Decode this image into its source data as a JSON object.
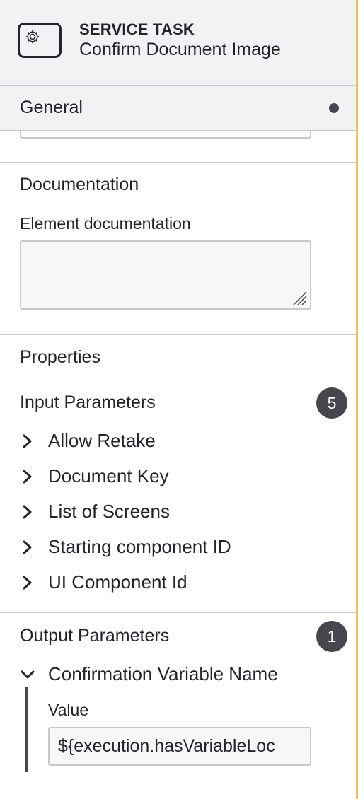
{
  "header": {
    "type_label": "SERVICE TASK",
    "element_name": "Confirm Document Image",
    "icon": "gear-icon"
  },
  "general": {
    "title": "General",
    "status": "modified-dot"
  },
  "documentation": {
    "title": "Documentation",
    "field_label": "Element documentation",
    "field_value": ""
  },
  "properties": {
    "title": "Properties"
  },
  "input_parameters": {
    "title": "Input Parameters",
    "count": "5",
    "items": [
      {
        "label": "Allow Retake"
      },
      {
        "label": "Document Key"
      },
      {
        "label": "List of Screens"
      },
      {
        "label": "Starting component ID"
      },
      {
        "label": "UI Component Id"
      }
    ]
  },
  "output_parameters": {
    "title": "Output Parameters",
    "count": "1",
    "items": [
      {
        "label": "Confirmation Variable Name",
        "expanded": true,
        "value_label": "Value",
        "value": "${execution.hasVariableLoc"
      }
    ]
  },
  "colors": {
    "header_bg": "#f1f2f3",
    "badge_bg": "#45464e",
    "accent_edge": "#f5c342",
    "border": "#c8c9cc"
  }
}
